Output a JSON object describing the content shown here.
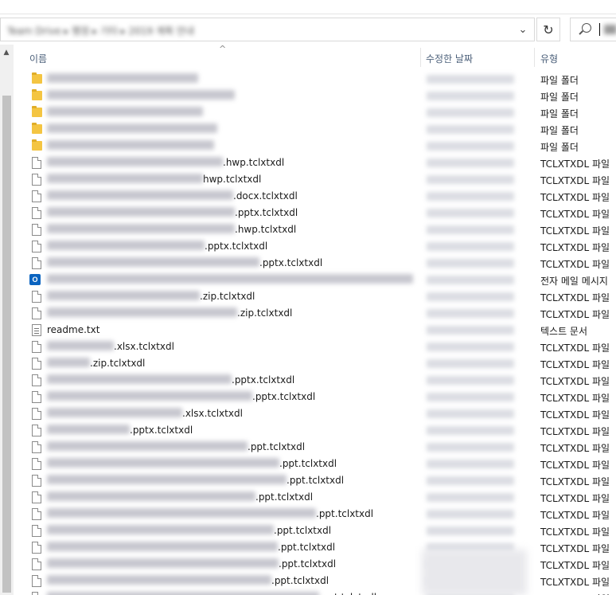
{
  "columns": {
    "name": "이름",
    "date_modified": "수정한 날짜",
    "type": "유형"
  },
  "icons": {
    "refresh": "↻",
    "dropdown": "⌄",
    "scroll_up": "▲",
    "sort": "^"
  },
  "address": {
    "path": "Team Drive ▸ 행정 ▸ 기타 ▸ 2019 계획 안내"
  },
  "files": [
    {
      "icon": "folder",
      "name_visible": "",
      "type": "파일 폴더"
    },
    {
      "icon": "folder",
      "name_visible": "",
      "type": "파일 폴더"
    },
    {
      "icon": "folder",
      "name_visible": "",
      "type": "파일 폴더"
    },
    {
      "icon": "folder",
      "name_visible": "",
      "type": "파일 폴더"
    },
    {
      "icon": "folder",
      "name_visible": "",
      "type": "파일 폴더"
    },
    {
      "icon": "file",
      "name_visible": ".hwp.tclxtxdl",
      "type": "TCLXTXDL 파일"
    },
    {
      "icon": "file",
      "name_visible": "hwp.tclxtxdl",
      "type": "TCLXTXDL 파일"
    },
    {
      "icon": "file",
      "name_visible": ".docx.tclxtxdl",
      "type": "TCLXTXDL 파일"
    },
    {
      "icon": "file",
      "name_visible": ".pptx.tclxtxdl",
      "type": "TCLXTXDL 파일"
    },
    {
      "icon": "file",
      "name_visible": ".hwp.tclxtxdl",
      "type": "TCLXTXDL 파일"
    },
    {
      "icon": "file",
      "name_visible": ".pptx.tclxtxdl",
      "type": "TCLXTXDL 파일"
    },
    {
      "icon": "file",
      "name_visible": ".pptx.tclxtxdl",
      "type": "TCLXTXDL 파일"
    },
    {
      "icon": "mail",
      "name_visible": "",
      "type": "전자 메일 메시지"
    },
    {
      "icon": "file",
      "name_visible": ".zip.tclxtxdl",
      "type": "TCLXTXDL 파일"
    },
    {
      "icon": "file",
      "name_visible": ".zip.tclxtxdl",
      "type": "TCLXTXDL 파일"
    },
    {
      "icon": "text",
      "name_visible": "readme.txt",
      "type": "텍스트 문서"
    },
    {
      "icon": "file",
      "name_visible": ".xlsx.tclxtxdl",
      "type": "TCLXTXDL 파일"
    },
    {
      "icon": "file",
      "name_visible": ".zip.tclxtxdl",
      "type": "TCLXTXDL 파일"
    },
    {
      "icon": "file",
      "name_visible": ".pptx.tclxtxdl",
      "type": "TCLXTXDL 파일"
    },
    {
      "icon": "file",
      "name_visible": ".pptx.tclxtxdl",
      "type": "TCLXTXDL 파일"
    },
    {
      "icon": "file",
      "name_visible": ".xlsx.tclxtxdl",
      "type": "TCLXTXDL 파일"
    },
    {
      "icon": "file",
      "name_visible": ".pptx.tclxtxdl",
      "type": "TCLXTXDL 파일"
    },
    {
      "icon": "file",
      "name_visible": ".ppt.tclxtxdl",
      "type": "TCLXTXDL 파일"
    },
    {
      "icon": "file",
      "name_visible": ".ppt.tclxtxdl",
      "type": "TCLXTXDL 파일"
    },
    {
      "icon": "file",
      "name_visible": ".ppt.tclxtxdl",
      "type": "TCLXTXDL 파일"
    },
    {
      "icon": "file",
      "name_visible": ".ppt.tclxtxdl",
      "type": "TCLXTXDL 파일"
    },
    {
      "icon": "file",
      "name_visible": ".ppt.tclxtxdl",
      "type": "TCLXTXDL 파일"
    },
    {
      "icon": "file",
      "name_visible": ".ppt.tclxtxdl",
      "type": "TCLXTXDL 파일"
    },
    {
      "icon": "file",
      "name_visible": ".ppt.tclxtxdl",
      "type": "TCLXTXDL 파일"
    },
    {
      "icon": "file",
      "name_visible": ".ppt.tclxtxdl",
      "type": "TCLXTXDL 파일"
    },
    {
      "icon": "file",
      "name_visible": ".ppt.tclxtxdl",
      "type": "TCLXTXDL 파일"
    },
    {
      "icon": "file",
      "name_visible": ".ppt.tclxtxdl",
      "type": "TCLXTXDL 파일"
    }
  ]
}
